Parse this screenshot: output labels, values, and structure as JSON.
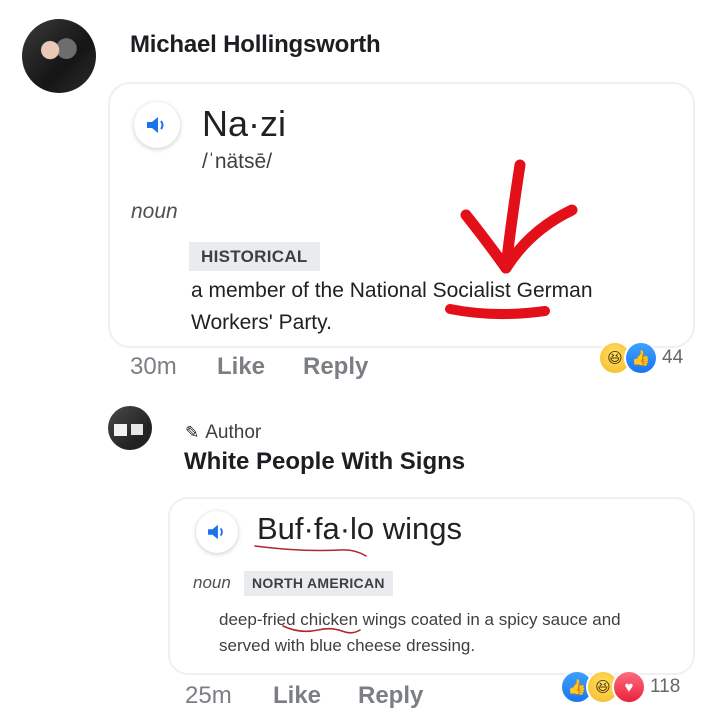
{
  "comments": [
    {
      "author": "Michael Hollingsworth",
      "definition": {
        "word": "Na·zi",
        "pronunciation": "/ˈnätsē/",
        "part_of_speech": "noun",
        "tag": "HISTORICAL",
        "text": "a member of the National Socialist German Workers' Party."
      },
      "meta": {
        "time": "30m",
        "like": "Like",
        "reply": "Reply"
      },
      "reactions": {
        "icons": [
          "haha-icon",
          "like-icon"
        ],
        "count": "44"
      }
    },
    {
      "author_badge": "Author",
      "author": "White People With Signs",
      "definition": {
        "word": "Buf·fa·lo wings",
        "part_of_speech": "noun",
        "tag": "NORTH AMERICAN",
        "text": "deep-fried chicken wings coated in a spicy sauce and served with blue cheese dressing."
      },
      "meta": {
        "time": "25m",
        "like": "Like",
        "reply": "Reply"
      },
      "reactions": {
        "icons": [
          "like-icon",
          "haha-icon",
          "love-icon"
        ],
        "count": "118"
      }
    }
  ],
  "colors": {
    "annotation_red": "#e3101a",
    "meta_gray": "#7b7f84",
    "fb_blue": "#1877f2",
    "speaker_blue": "#1a73e8"
  }
}
